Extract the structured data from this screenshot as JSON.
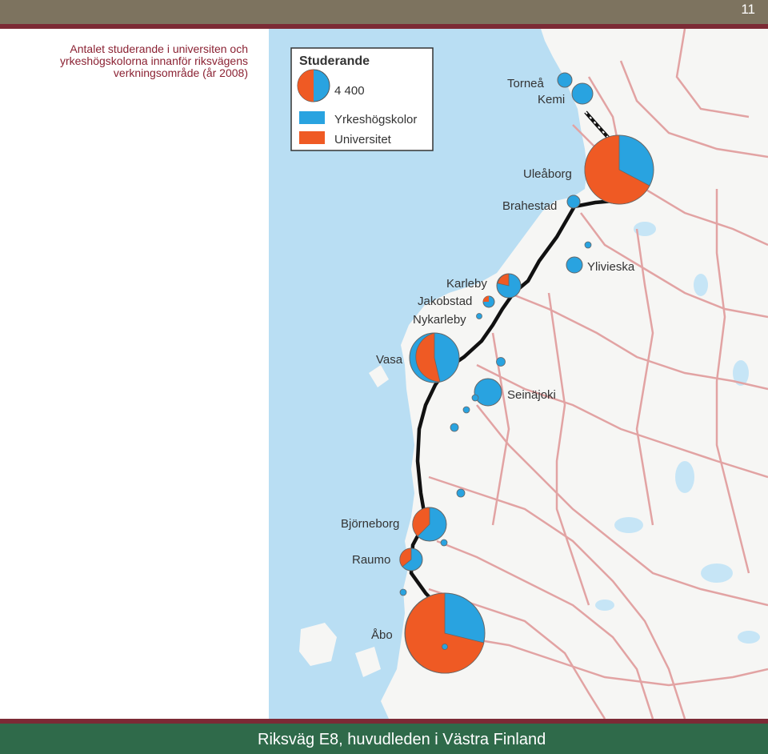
{
  "page_number": "11",
  "caption": {
    "line1": "Antalet studerande i universiten och",
    "line2": "yrkeshögskolorna innanför riksvägens",
    "line3": "verkningsområde (år 2008)"
  },
  "legend": {
    "title": "Studerande",
    "size_value": "4 400",
    "polytechnic_label": "Yrkeshögskolor",
    "university_label": "Universitet"
  },
  "cities": {
    "tornea": "Torneå",
    "kemi": "Kemi",
    "uleaborg": "Uleåborg",
    "brahestad": "Brahestad",
    "ylivieska": "Ylivieska",
    "karleby": "Karleby",
    "jakobstad": "Jakobstad",
    "nykarleby": "Nykarleby",
    "vasa": "Vasa",
    "seinajoki": "Seinäjoki",
    "bjorneborg": "Björneborg",
    "raumo": "Raumo",
    "abo": "Åbo"
  },
  "colors": {
    "polytechnic": "#29a3e0",
    "university": "#ef5a24",
    "sea": "#b9def3",
    "land": "#f6f6f4",
    "roads": "#e2a3a3",
    "main_road": "#111111",
    "accent_red": "#8b2233",
    "footer_green": "#2f6a4a"
  },
  "footer": {
    "title": "Riksväg E8, huvudleden i Västra Finland"
  }
}
